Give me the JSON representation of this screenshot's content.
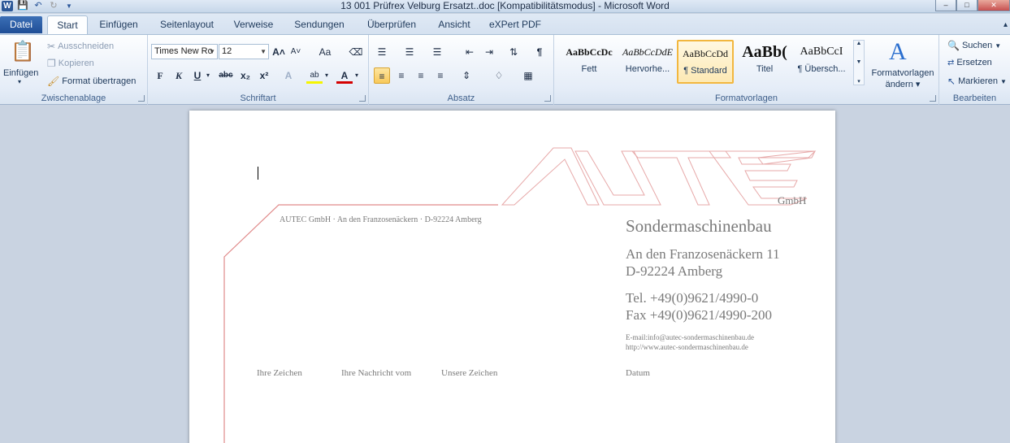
{
  "window": {
    "title": "13 001 Prüfrex Velburg Ersatzt..doc [Kompatibilitätsmodus]  -  Microsoft Word",
    "app_icon_text": "W",
    "qat_icons": [
      "save-icon",
      "undo-icon",
      "redo-icon",
      "customize-qat-icon"
    ]
  },
  "tabs": [
    {
      "label": "Datei"
    },
    {
      "label": "Start"
    },
    {
      "label": "Einfügen"
    },
    {
      "label": "Seitenlayout"
    },
    {
      "label": "Verweise"
    },
    {
      "label": "Sendungen"
    },
    {
      "label": "Überprüfen"
    },
    {
      "label": "Ansicht"
    },
    {
      "label": "eXPert PDF"
    }
  ],
  "ribbon": {
    "clipboard": {
      "label": "Zwischenablage",
      "paste": "Einfügen",
      "cut": "Ausschneiden",
      "copy": "Kopieren",
      "format_painter": "Format übertragen"
    },
    "font": {
      "label": "Schriftart",
      "font_name": "Times New Ro",
      "font_size": "12",
      "bold": "F",
      "italic": "K",
      "underline": "U",
      "strike": "abc",
      "subscript": "x₂",
      "superscript": "x²",
      "grow": "A˄",
      "shrink": "A˅",
      "case": "Aa",
      "highlight": "ab",
      "font_color": "A"
    },
    "paragraph": {
      "label": "Absatz"
    },
    "styles": {
      "label": "Formatvorlagen",
      "items": [
        {
          "sample": "AaBbCcDc",
          "name": "Fett"
        },
        {
          "sample": "AaBbCcDdE",
          "name": "Hervorhe..."
        },
        {
          "sample": "AaBbCcDd",
          "name": "¶ Standard"
        },
        {
          "sample": "AaBb(",
          "name": "Titel"
        },
        {
          "sample": "AaBbCcI",
          "name": "¶ Übersch..."
        }
      ],
      "change_styles_line1": "Formatvorlagen",
      "change_styles_line2": "ändern ▾"
    },
    "editing": {
      "label": "Bearbeiten",
      "find": "Suchen",
      "replace": "Ersetzen",
      "select": "Markieren"
    }
  },
  "document": {
    "logo_text": "AUTEC",
    "gmbh": "GmbH",
    "sender_line": "AUTEC GmbH · An den Franzosenäckern · D-92224 Amberg",
    "company_desc": "Sondermaschinenbau",
    "street": "An den Franzosenäckern 11",
    "city": "D-92224 Amberg",
    "tel": "Tel. +49(0)9621/4990-0",
    "fax": "Fax +49(0)9621/4990-200",
    "email": "E-mail:info@autec-sondermaschinenbau.de",
    "web": "http://www.autec-sondermaschinenbau.de",
    "ref_labels": [
      "Ihre Zeichen",
      "Ihre Nachricht vom",
      "Unsere Zeichen",
      "Datum"
    ],
    "accent_color": "#e08a8a"
  }
}
